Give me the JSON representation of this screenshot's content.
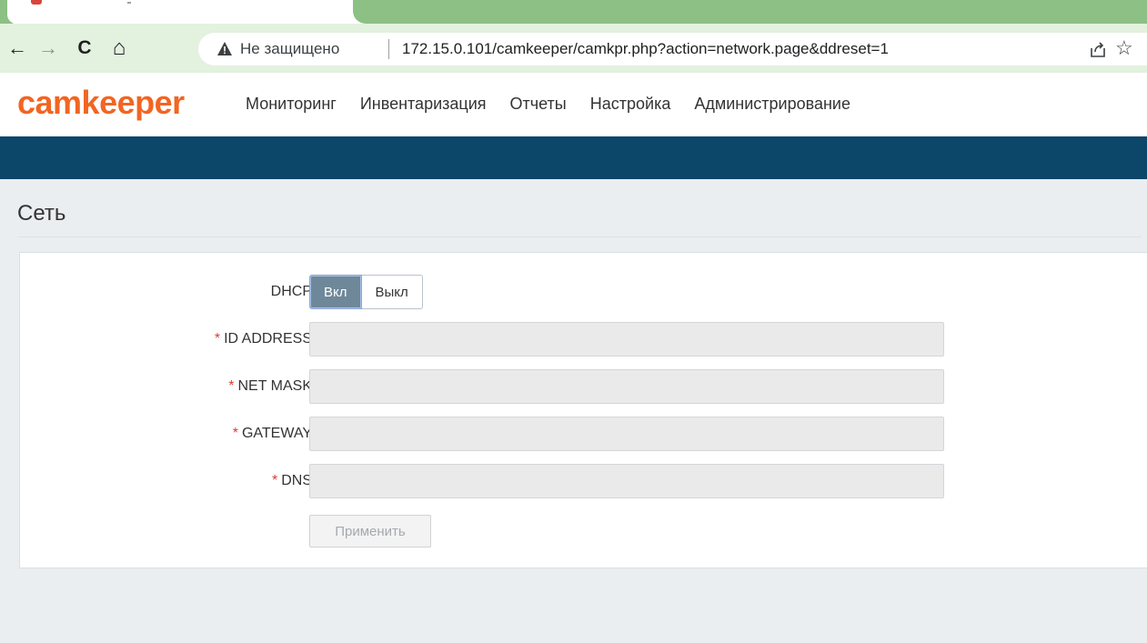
{
  "browser": {
    "insecure_label": "Не защищено",
    "url": "172.15.0.101/camkeeper/camkpr.php?action=network.page&ddreset=1",
    "back_glyph": "←",
    "forward_glyph": "→",
    "reload_glyph": "C",
    "home_glyph": "⌂",
    "star_glyph": "☆",
    "icons": [
      "back-arrow-icon",
      "forward-arrow-icon",
      "reload-icon",
      "home-icon",
      "warning-icon",
      "share-icon",
      "star-icon"
    ]
  },
  "app": {
    "logo": "camkeeper",
    "menu": [
      "Мониторинг",
      "Инвентаризация",
      "Отчеты",
      "Настройка",
      "Администрирование"
    ]
  },
  "page": {
    "title": "Сеть"
  },
  "form": {
    "dhcp_label": "DHCP",
    "dhcp_on": "Вкл",
    "dhcp_off": "Выкл",
    "dhcp_selected": "Вкл",
    "required_mark": "*",
    "fields": [
      {
        "label": "ID ADDRESS",
        "value": ""
      },
      {
        "label": "NET MASK",
        "value": ""
      },
      {
        "label": "GATEWAY",
        "value": ""
      },
      {
        "label": "DNS",
        "value": ""
      }
    ],
    "apply_label": "Применить"
  },
  "colors": {
    "brand": "#f26522",
    "nav_bar": "#0c4669",
    "toggle_active": "#6f8899",
    "required": "#e03c31",
    "browser_theme": "#8cc084"
  }
}
